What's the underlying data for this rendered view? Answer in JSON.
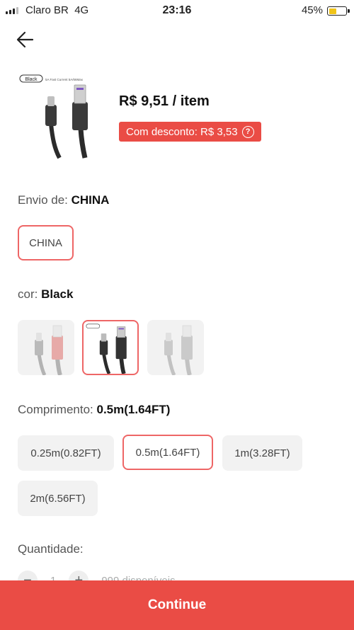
{
  "status_bar": {
    "carrier": "Claro BR",
    "network": "4G",
    "time": "23:16",
    "battery": "45%",
    "battery_level": 0.45
  },
  "product": {
    "price": "R$ 9,51 / item",
    "discount": "Com desconto: R$ 3,53",
    "thumb_badge": "Black",
    "thumb_text": "5A Fast Current 5A/66Max"
  },
  "shipping": {
    "label": "Envio de:",
    "selected": "CHINA",
    "options": [
      "CHINA"
    ]
  },
  "color": {
    "label": "cor:",
    "selected": "Black",
    "options": [
      "Red",
      "Black",
      "Gray"
    ]
  },
  "length": {
    "label": "Comprimento:",
    "selected": "0.5m(1.64FT)",
    "options": [
      "0.25m(0.82FT)",
      "0.5m(1.64FT)",
      "1m(3.28FT)",
      "2m(6.56FT)"
    ]
  },
  "quantity": {
    "label": "Quantidade",
    "value": "1",
    "available": "999 disponíveis"
  },
  "continue_label": "Continue",
  "colors": {
    "accent": "#ea4c45",
    "chip_bg": "#f2f2f2",
    "selected_border": "#e66666"
  },
  "icons": [
    "back-arrow-icon",
    "help-icon",
    "plus-icon",
    "minus-icon"
  ]
}
